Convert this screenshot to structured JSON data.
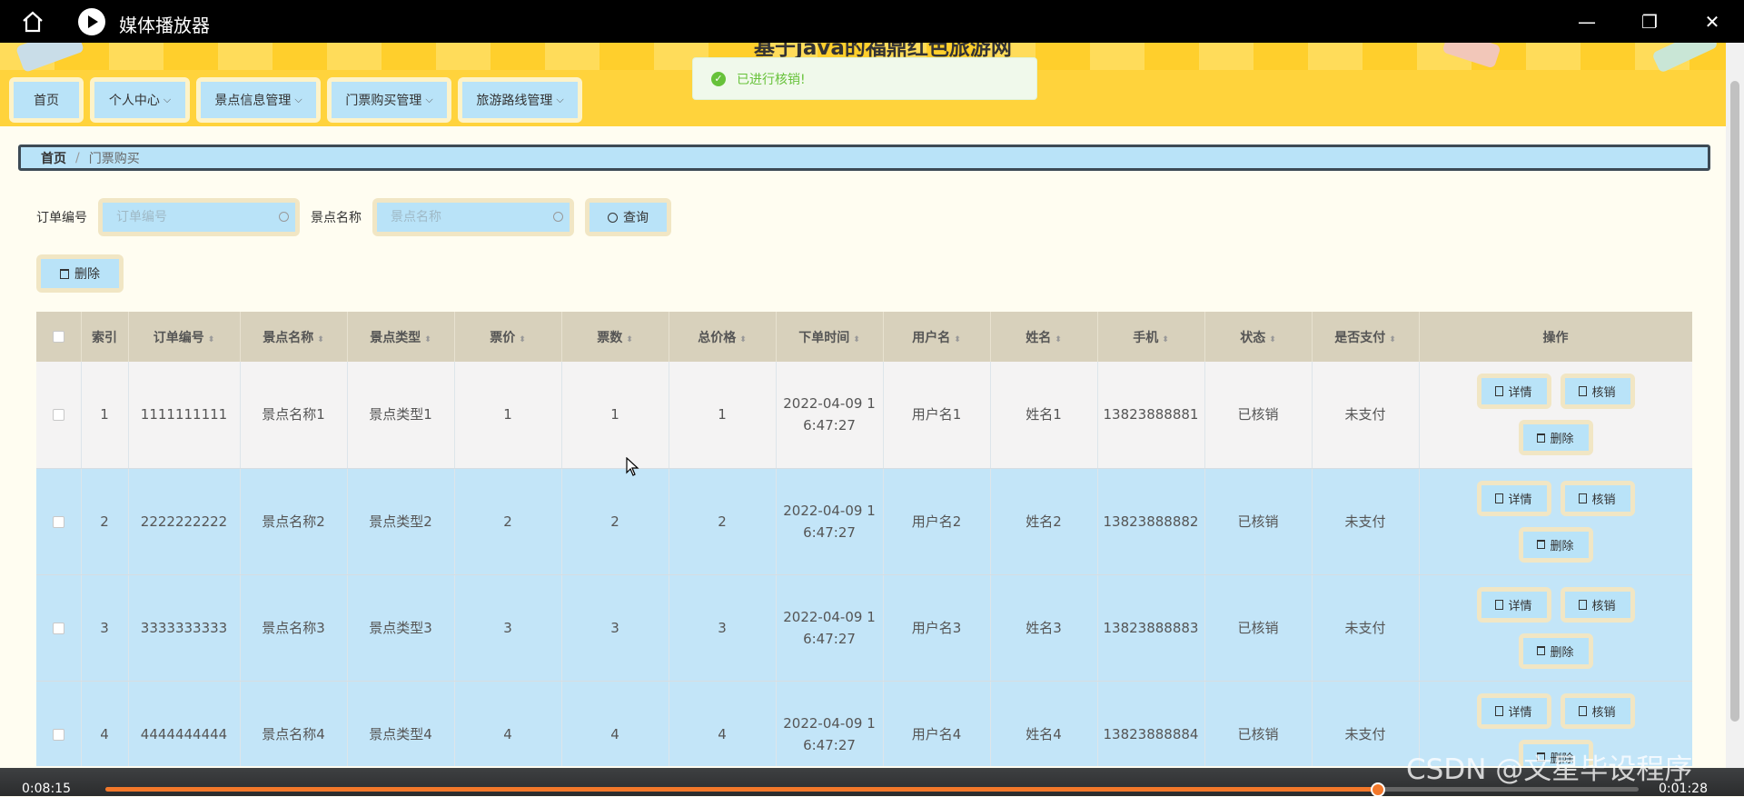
{
  "player": {
    "title": "媒体播放器",
    "time_elapsed": "0:08:15",
    "time_remaining": "0:01:28",
    "progress": 0.83,
    "watermark": "CSDN @文星毕设程序"
  },
  "site": {
    "title": "基于java的福鼎红色旅游网",
    "nav": [
      "首页",
      "个人中心",
      "景点信息管理",
      "门票购买管理",
      "旅游路线管理"
    ],
    "colors": {
      "header": "#ffd33c",
      "button": "#b9e3f8",
      "accent_border": "#f1e6c4"
    }
  },
  "toast": {
    "message": "已进行核销!"
  },
  "breadcrumb": {
    "home": "首页",
    "separator": "/",
    "current": "门票购买"
  },
  "search": {
    "order_label": "订单编号",
    "order_placeholder": "订单编号",
    "spot_label": "景点名称",
    "spot_placeholder": "景点名称",
    "query_button": "查询"
  },
  "delete_button": "删除",
  "table": {
    "headers": [
      "索引",
      "订单编号",
      "景点名称",
      "景点类型",
      "票价",
      "票数",
      "总价格",
      "下单时间",
      "用户名",
      "姓名",
      "手机",
      "状态",
      "是否支付",
      "操作"
    ],
    "actions": {
      "detail": "详情",
      "verify": "核销",
      "delete": "删除"
    },
    "rows": [
      {
        "index": "1",
        "order_no": "1111111111",
        "spot_name": "景点名称1",
        "spot_type": "景点类型1",
        "price": "1",
        "count": "1",
        "total": "1",
        "time_line1": "2022-04-09 1",
        "time_line2": "6:47:27",
        "username": "用户名1",
        "name": "姓名1",
        "phone": "13823888881",
        "status": "已核销",
        "paid": "未支付"
      },
      {
        "index": "2",
        "order_no": "2222222222",
        "spot_name": "景点名称2",
        "spot_type": "景点类型2",
        "price": "2",
        "count": "2",
        "total": "2",
        "time_line1": "2022-04-09 1",
        "time_line2": "6:47:27",
        "username": "用户名2",
        "name": "姓名2",
        "phone": "13823888882",
        "status": "已核销",
        "paid": "未支付"
      },
      {
        "index": "3",
        "order_no": "3333333333",
        "spot_name": "景点名称3",
        "spot_type": "景点类型3",
        "price": "3",
        "count": "3",
        "total": "3",
        "time_line1": "2022-04-09 1",
        "time_line2": "6:47:27",
        "username": "用户名3",
        "name": "姓名3",
        "phone": "13823888883",
        "status": "已核销",
        "paid": "未支付"
      },
      {
        "index": "4",
        "order_no": "4444444444",
        "spot_name": "景点名称4",
        "spot_type": "景点类型4",
        "price": "4",
        "count": "4",
        "total": "4",
        "time_line1": "2022-04-09 1",
        "time_line2": "6:47:27",
        "username": "用户名4",
        "name": "姓名4",
        "phone": "13823888884",
        "status": "已核销",
        "paid": "未支付"
      }
    ]
  }
}
